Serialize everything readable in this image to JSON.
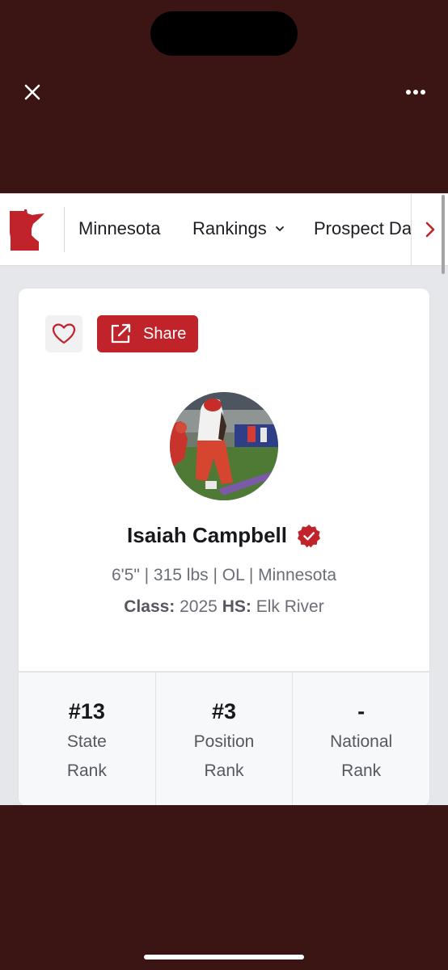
{
  "top_bar": {
    "close_icon": "close-icon",
    "more_icon": "more-horizontal-icon"
  },
  "nav": {
    "logo_icon": "minnesota-state-icon",
    "items": [
      "Minnesota",
      "Rankings",
      "Prospect Da"
    ],
    "scroll_icon": "chevron-right-icon"
  },
  "profile": {
    "favorite_icon": "heart-icon",
    "share_icon": "external-link-icon",
    "share_label": "Share",
    "name": "Isaiah Campbell",
    "bio": "6'5\" | 315 lbs | OL | Minnesota",
    "class_label": "Class:",
    "class_value": " 2025 ",
    "hs_label": "HS:",
    "hs_value": " Elk River"
  },
  "stats": [
    {
      "value": "#13",
      "label_line1": "State",
      "label_line2": "Rank"
    },
    {
      "value": "#3",
      "label_line1": "Position",
      "label_line2": "Rank"
    },
    {
      "value": "-",
      "label_line1": "National",
      "label_line2": "Rank"
    }
  ],
  "colors": {
    "brand_red": "#c0232a",
    "app_chrome": "#3a1514"
  }
}
